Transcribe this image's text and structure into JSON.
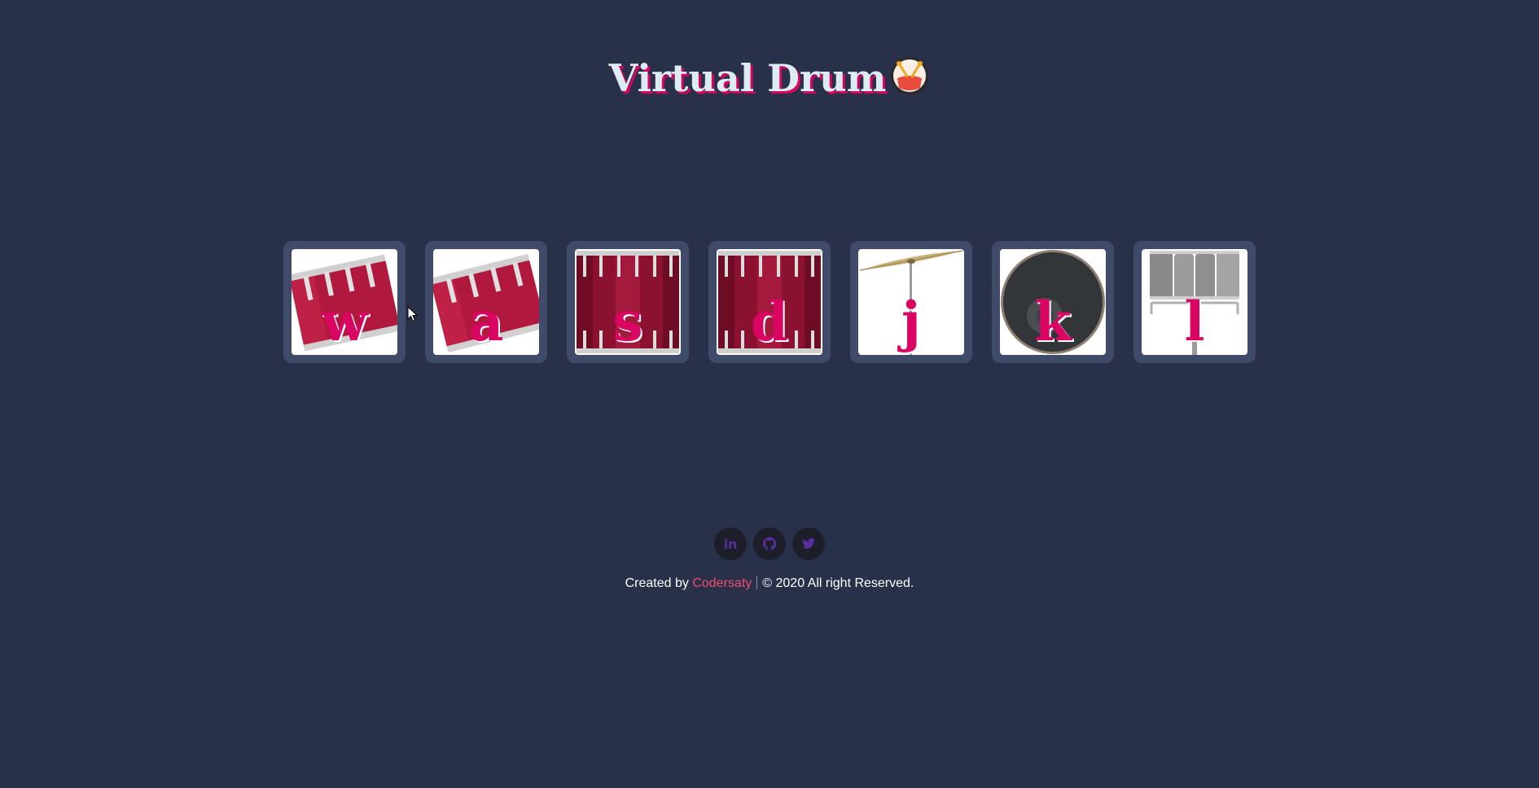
{
  "header": {
    "title": "Virtual Drum",
    "emoji_icon": "drum-face-icon"
  },
  "drums": [
    {
      "key": "w",
      "icon": "tom-drum-tilted-icon",
      "color": "#b0183d"
    },
    {
      "key": "a",
      "icon": "tom-drum-tilted-icon",
      "color": "#b0183d"
    },
    {
      "key": "s",
      "icon": "snare-drum-icon",
      "color": "#8a1230"
    },
    {
      "key": "d",
      "icon": "snare-drum-icon",
      "color": "#8a1230"
    },
    {
      "key": "j",
      "icon": "cymbal-icon",
      "color": "#c9b27a"
    },
    {
      "key": "k",
      "icon": "bass-drum-icon",
      "color": "#333638"
    },
    {
      "key": "l",
      "icon": "drum-rack-icon",
      "color": "#8a8a8a"
    }
  ],
  "social": [
    {
      "label": "in",
      "icon": "linkedin-icon"
    },
    {
      "label": "",
      "icon": "github-icon"
    },
    {
      "label": "",
      "icon": "twitter-icon"
    }
  ],
  "footer": {
    "created_by": "Created by",
    "author": "Codersaty",
    "copyright": "© 2020 All right Reserved."
  },
  "colors": {
    "background": "#283149",
    "tile": "#404b69",
    "accent": "#da0463",
    "title": "#dbedf3",
    "author": "#f0506e"
  }
}
